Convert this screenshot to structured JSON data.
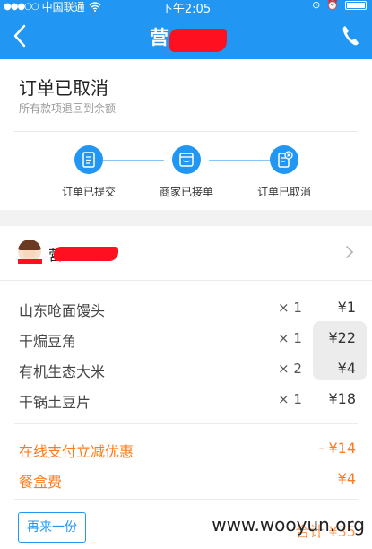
{
  "status_bar": {
    "carrier": "中国联通",
    "time": "下午2:05"
  },
  "nav": {
    "title": "营",
    "title_redacted": true
  },
  "order_status": {
    "title": "订单已取消",
    "subtitle": "所有款项退回到余额",
    "steps": [
      {
        "label": "订单已提交",
        "icon": "document-icon"
      },
      {
        "label": "商家已接单",
        "icon": "store-icon"
      },
      {
        "label": "订单已取消",
        "icon": "cancelled-document-icon"
      }
    ]
  },
  "shop": {
    "name": "营",
    "name_redacted": true
  },
  "items": [
    {
      "name": "山东呛面馒头",
      "qty": "× 1",
      "price": "¥1"
    },
    {
      "name": "干煸豆角",
      "qty": "× 1",
      "price": "¥22"
    },
    {
      "name": "有机生态大米",
      "qty": "× 2",
      "price": "¥4"
    },
    {
      "name": "干锅土豆片",
      "qty": "× 1",
      "price": "¥18"
    }
  ],
  "fees": [
    {
      "name": "在线支付立减优惠",
      "amount": "- ¥14"
    },
    {
      "name": "餐盒费",
      "amount": "¥4"
    }
  ],
  "actions": {
    "reorder_label": "再来一份"
  },
  "summary": {
    "total": "合计 ¥35"
  },
  "watermark": "www.wooyun.org",
  "colors": {
    "primary": "#2196f3",
    "accent": "#ff7a1a",
    "redaction": "#ff1020"
  }
}
